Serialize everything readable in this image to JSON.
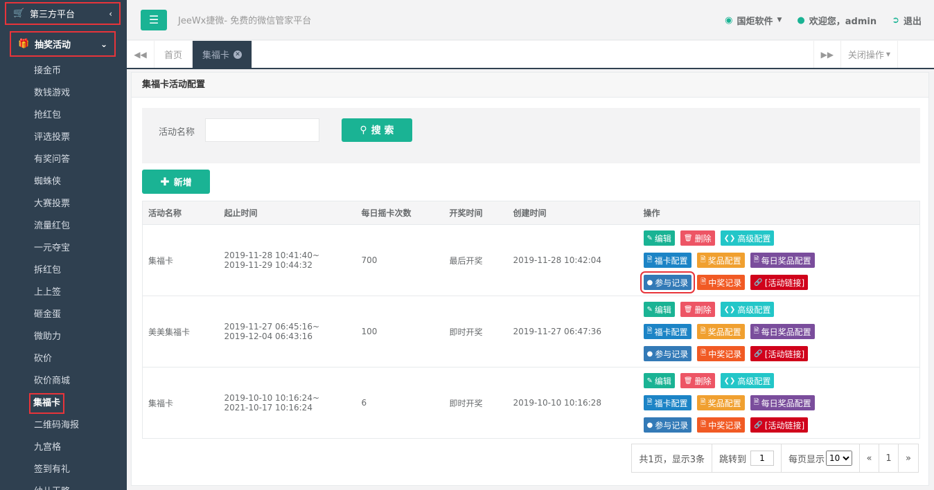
{
  "sidebar": {
    "group1": {
      "label": "第三方平台",
      "icon": "cart-icon"
    },
    "group2": {
      "label": "抽奖活动",
      "icon": "gift-icon"
    },
    "items": [
      "接金币",
      "数钱游戏",
      "抢红包",
      "评选投票",
      "有奖问答",
      "蜘蛛侠",
      "大赛投票",
      "流量红包",
      "一元夺宝",
      "拆红包",
      "上上签",
      "砸金蛋",
      "微助力",
      "砍价",
      "砍价商城",
      "集福卡",
      "二维码海报",
      "九宫格",
      "签到有礼",
      "幼儿王略"
    ],
    "active_item": "集福卡"
  },
  "topbar": {
    "brand": "JeeWx捷微- 免费的微信管家平台",
    "company": "国炬软件",
    "welcome": "欢迎您，admin",
    "logout": "退出"
  },
  "tabs": {
    "home": "首页",
    "current": "集福卡",
    "close_ops": "关闭操作"
  },
  "panel": {
    "title": "集福卡活动配置",
    "search_label": "活动名称",
    "search_value": "",
    "search_btn": "搜 索",
    "add_btn": "新增"
  },
  "table": {
    "headers": [
      "活动名称",
      "起止时间",
      "每日摇卡次数",
      "开奖时间",
      "创建时间",
      "操作"
    ],
    "rows": [
      {
        "name": "集福卡",
        "start": "2019-11-28 10:41:40~",
        "end": "2019-11-29 10:44:32",
        "times": "700",
        "draw": "最后开奖",
        "created": "2019-11-28 10:42:04"
      },
      {
        "name": "美美集福卡",
        "start": "2019-11-27 06:45:16~",
        "end": "2019-12-04 06:43:16",
        "times": "100",
        "draw": "即时开奖",
        "created": "2019-11-27 06:47:36"
      },
      {
        "name": "集福卡",
        "start": "2019-10-10 10:16:24~",
        "end": "2021-10-17 10:16:24",
        "times": "6",
        "draw": "即时开奖",
        "created": "2019-10-10 10:16:28"
      }
    ],
    "ops": {
      "edit": "编辑",
      "delete": "删除",
      "advanced": "高级配置",
      "card": "福卡配置",
      "prize": "奖品配置",
      "daily": "每日奖品配置",
      "join": "参与记录",
      "win": "中奖记录",
      "link": "[活动链接]"
    }
  },
  "pager": {
    "summary": "共1页，显示3条",
    "jump_label": "跳转到",
    "jump_value": "1",
    "per_page_label": "每页显示",
    "per_page_value": "10",
    "prev": "«",
    "page": "1",
    "next": "»"
  }
}
